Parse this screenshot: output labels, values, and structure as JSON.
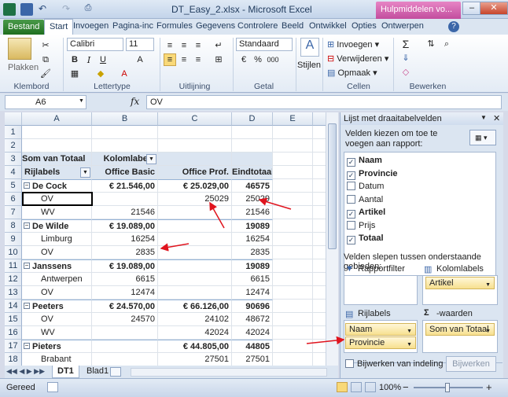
{
  "window": {
    "title": "DT_Easy_2.xlsx - Microsoft Excel",
    "contextual_tab": "Hulpmiddelen vo..."
  },
  "tabs": [
    "Bestand",
    "Start",
    "Invoegen",
    "Pagina-inc",
    "Formules",
    "Gegevens",
    "Controlere",
    "Beeld",
    "Ontwikkel",
    "Opties",
    "Ontwerpen"
  ],
  "ribbon": {
    "plakken": "Plakken",
    "klembord": "Klembord",
    "font_name": "Calibri",
    "font_size": "11",
    "lettertype": "Lettertype",
    "uitlijning": "Uitlijning",
    "number_format": "Standaard",
    "getal": "Getal",
    "stijlen": "Stijlen",
    "invoegen": "Invoegen",
    "verwijderen": "Verwijderen",
    "opmaak": "Opmaak",
    "cellen": "Cellen",
    "bewerken": "Bewerken",
    "bold": "B",
    "italic": "I",
    "underline": "U",
    "currency": "€",
    "percent": "%",
    "thousands": "000"
  },
  "formula_bar": {
    "cell": "A6",
    "fx": "fx",
    "value": "OV"
  },
  "columns": [
    "A",
    "B",
    "C",
    "D",
    "E",
    "F"
  ],
  "rows": [
    {
      "n": "1",
      "a": "",
      "b": "",
      "c": "",
      "d": ""
    },
    {
      "n": "2",
      "a": "",
      "b": "",
      "c": "",
      "d": ""
    },
    {
      "n": "3",
      "a": "Som van Totaal",
      "b": "Kolomlabels",
      "c": "",
      "d": ""
    },
    {
      "n": "4",
      "a": "Rijlabels",
      "b": "Office Basic",
      "c": "Office Prof.",
      "d": "Eindtotaal"
    },
    {
      "n": "5",
      "a": "De Cock",
      "b": "€ 21.546,00",
      "c": "€ 25.029,00",
      "d": "46575"
    },
    {
      "n": "6",
      "a": "OV",
      "b": "",
      "c": "25029",
      "d": "25029"
    },
    {
      "n": "7",
      "a": "WV",
      "b": "21546",
      "c": "",
      "d": "21546"
    },
    {
      "n": "8",
      "a": "De Wilde",
      "b": "€ 19.089,00",
      "c": "",
      "d": "19089"
    },
    {
      "n": "9",
      "a": "Limburg",
      "b": "16254",
      "c": "",
      "d": "16254"
    },
    {
      "n": "10",
      "a": "OV",
      "b": "2835",
      "c": "",
      "d": "2835"
    },
    {
      "n": "11",
      "a": "Janssens",
      "b": "€ 19.089,00",
      "c": "",
      "d": "19089"
    },
    {
      "n": "12",
      "a": "Antwerpen",
      "b": "6615",
      "c": "",
      "d": "6615"
    },
    {
      "n": "13",
      "a": "OV",
      "b": "12474",
      "c": "",
      "d": "12474"
    },
    {
      "n": "14",
      "a": "Peeters",
      "b": "€ 24.570,00",
      "c": "€ 66.126,00",
      "d": "90696"
    },
    {
      "n": "15",
      "a": "OV",
      "b": "24570",
      "c": "24102",
      "d": "48672"
    },
    {
      "n": "16",
      "a": "WV",
      "b": "",
      "c": "42024",
      "d": "42024"
    },
    {
      "n": "17",
      "a": "Pieters",
      "b": "",
      "c": "€ 44.805,00",
      "d": "44805"
    },
    {
      "n": "18",
      "a": "Brabant",
      "b": "",
      "c": "27501",
      "d": "27501"
    }
  ],
  "sheets": [
    "DT1",
    "Blad1"
  ],
  "status": {
    "ready": "Gereed",
    "zoom": "100%",
    "minus": "−",
    "plus": "+"
  },
  "pane": {
    "title": "Lijst met draaitabelvelden",
    "choose_label": "Velden kiezen om toe te voegen aan rapport:",
    "fields": [
      {
        "name": "Naam",
        "checked": true
      },
      {
        "name": "Provincie",
        "checked": true
      },
      {
        "name": "Datum",
        "checked": false
      },
      {
        "name": "Aantal",
        "checked": false
      },
      {
        "name": "Artikel",
        "checked": true
      },
      {
        "name": "Prijs",
        "checked": false
      },
      {
        "name": "Totaal",
        "checked": true
      }
    ],
    "drag_label": "Velden slepen tussen onderstaande gebieden:",
    "rapportfilter": "Rapportfilter",
    "kolomlabels": "Kolomlabels",
    "rijlabels": "Rijlabels",
    "waarden": "-waarden",
    "col_item": "Artikel",
    "row_items": [
      "Naam",
      "Provincie"
    ],
    "value_item": "Som van Totaal",
    "defer_label": "Bijwerken van indeling ...",
    "update_button": "Bijwerken"
  }
}
